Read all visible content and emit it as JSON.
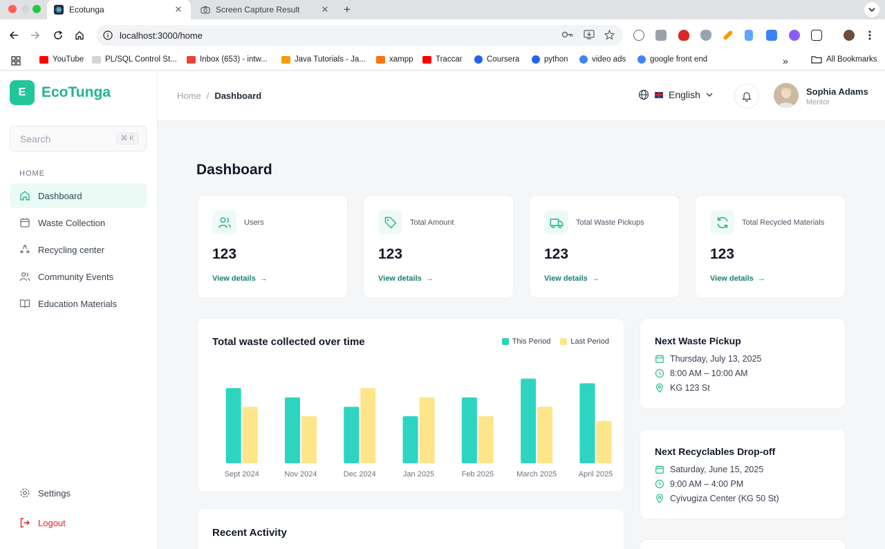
{
  "browser": {
    "tabs": [
      {
        "title": "Ecotunga",
        "icon": "react-icon"
      },
      {
        "title": "Screen Capture Result",
        "icon": "camera-icon"
      }
    ],
    "url": "localhost:3000/home",
    "bookmarks": [
      {
        "label": "YouTube",
        "color": "#ff0000"
      },
      {
        "label": "PL/SQL Control St...",
        "color": "#9ca3af"
      },
      {
        "label": "Inbox (653) - intw...",
        "color": "#ea4335"
      },
      {
        "label": "Java Tutorials - Ja...",
        "color": "#f59e0b"
      },
      {
        "label": "xampp",
        "color": "#f97316"
      },
      {
        "label": "Traccar",
        "color": "#ff0000"
      },
      {
        "label": "Coursera",
        "color": "#2563eb"
      },
      {
        "label": "python",
        "color": "#2563eb"
      },
      {
        "label": "video ads",
        "color": "#4285f4"
      },
      {
        "label": "google front end",
        "color": "#4285f4"
      }
    ],
    "all_bookmarks": "All Bookmarks"
  },
  "app": {
    "logo_letter": "E",
    "name": "EcoTunga",
    "accent": "#21c79b"
  },
  "sidebar": {
    "search_placeholder": "Search",
    "search_shortcut": "⌘ K",
    "section": "HOME",
    "items": [
      {
        "label": "Dashboard",
        "icon": "home-icon"
      },
      {
        "label": "Waste Collection",
        "icon": "calendar-icon"
      },
      {
        "label": "Recycling center",
        "icon": "recycle-icon"
      },
      {
        "label": "Community Events",
        "icon": "users-icon"
      },
      {
        "label": "Education Materials",
        "icon": "book-icon"
      }
    ],
    "settings": "Settings",
    "logout": "Logout"
  },
  "header": {
    "breadcrumb": [
      "Home",
      "/",
      "Dashboard"
    ],
    "language": "English",
    "user_name": "Sophia Adams",
    "user_role": "Mentor"
  },
  "main": {
    "title": "Dashboard",
    "stats": [
      {
        "label": "Users",
        "value": "123",
        "link": "View details",
        "icon": "users-icon"
      },
      {
        "label": "Total Amount",
        "value": "123",
        "link": "View details",
        "icon": "tag-icon"
      },
      {
        "label": "Total Waste Pickups",
        "value": "123",
        "link": "View details",
        "icon": "truck-icon"
      },
      {
        "label": "Total Recycled Materials",
        "value": "123",
        "link": "View details",
        "icon": "refresh-icon"
      }
    ],
    "next_pickup": {
      "title": "Next Waste Pickup",
      "date": "Thursday, July 13, 2025",
      "time": "8:00 AM – 10:00 AM",
      "location": "KG 123 St"
    },
    "next_dropoff": {
      "title": "Next Recyclables Drop-off",
      "date": "Saturday, June 15, 2025",
      "time": "9:00 AM – 4:00 PM",
      "location": "Cyivugiza Center (KG 50 St)"
    },
    "recent_title": "Recent Activity"
  },
  "chart_data": {
    "type": "bar",
    "title": "Total waste collected over time",
    "categories": [
      "Sept 2024",
      "Nov 2024",
      "Dec 2024",
      "Jan 2025",
      "Feb 2025",
      "March 2025",
      "April 2025"
    ],
    "series": [
      {
        "name": "This Period",
        "color": "#2dd4bf",
        "values": [
          80,
          70,
          60,
          50,
          70,
          90,
          85
        ]
      },
      {
        "name": "Last Period",
        "color": "#fde68a",
        "values": [
          60,
          50,
          80,
          70,
          50,
          60,
          45
        ]
      }
    ],
    "ylim": [
      0,
      100
    ],
    "grid": false,
    "legend": "top-right"
  }
}
